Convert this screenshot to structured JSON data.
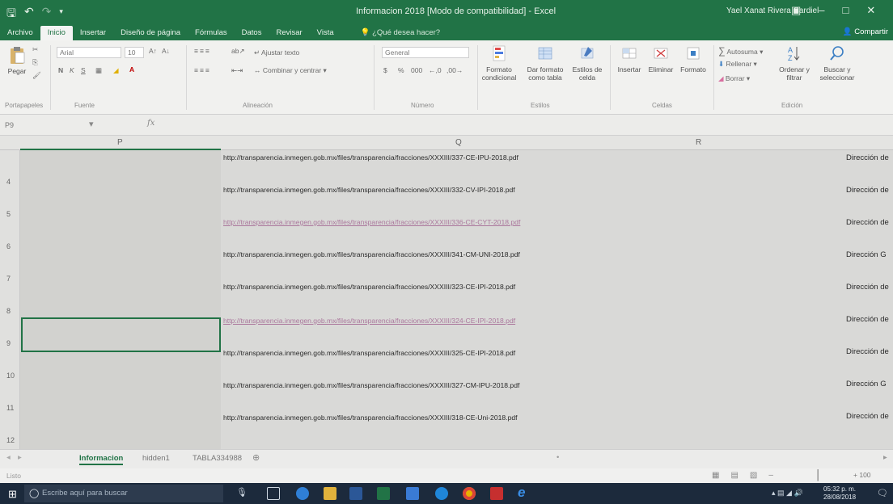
{
  "window": {
    "title": "Informacion 2018 [Modo de compatibilidad] - Excel",
    "user": "Yael Xanat Rivera Cardiel"
  },
  "ribbon_tabs": [
    "Archivo",
    "Inicio",
    "Insertar",
    "Diseño de página",
    "Fórmulas",
    "Datos",
    "Revisar",
    "Vista"
  ],
  "active_tab": "Inicio",
  "tell_me": "¿Qué desea hacer?",
  "share_label": "Compartir",
  "ribbon": {
    "clipboard": {
      "paste": "Pegar",
      "group": "Portapapeles"
    },
    "font": {
      "name": "Arial",
      "size": "10",
      "bold": "N",
      "italic": "K",
      "underline": "S",
      "group": "Fuente"
    },
    "alignment": {
      "wrap": "Ajustar texto",
      "merge": "Combinar y centrar",
      "group": "Alineación"
    },
    "number": {
      "format": "General",
      "currency": "$",
      "percent": "%",
      "thousands": "000",
      "group": "Número"
    },
    "styles": {
      "conditional": "Formato condicional",
      "table": "Dar formato como tabla",
      "cell_styles": "Estilos de celda",
      "group": "Estilos"
    },
    "cells": {
      "insert": "Insertar",
      "delete": "Eliminar",
      "format": "Formato",
      "group": "Celdas"
    },
    "editing": {
      "autosum": "Autosuma",
      "fill": "Rellenar",
      "clear": "Borrar",
      "sort": "Ordenar y filtrar",
      "find": "Buscar y seleccionar",
      "group": "Edición"
    }
  },
  "formula_bar": {
    "name_box": "P9",
    "fx": "fx",
    "content": ""
  },
  "columns": [
    "P",
    "Q",
    "R"
  ],
  "rows": [
    {
      "num": "4",
      "url": "http://transparencia.inmegen.gob.mx/files/transparencia/fracciones/XXXIII/332-CV-IPI-2018.pdf",
      "dir": "Dirección de",
      "visited": false
    },
    {
      "num": "5",
      "url": "http://transparencia.inmegen.gob.mx/files/transparencia/fracciones/XXXIII/336-CE-CYT-2018.pdf",
      "dir": "Dirección de",
      "visited": true
    },
    {
      "num": "6",
      "url": "http://transparencia.inmegen.gob.mx/files/transparencia/fracciones/XXXIII/341-CM-UNI-2018.pdf",
      "dir": "Dirección G",
      "visited": false
    },
    {
      "num": "7",
      "url": "http://transparencia.inmegen.gob.mx/files/transparencia/fracciones/XXXIII/323-CE-IPI-2018.pdf",
      "dir": "Dirección de",
      "visited": false
    },
    {
      "num": "8",
      "url": "http://transparencia.inmegen.gob.mx/files/transparencia/fracciones/XXXIII/324-CE-IPI-2018.pdf",
      "dir": "Dirección de",
      "visited": true
    },
    {
      "num": "9",
      "url": "http://transparencia.inmegen.gob.mx/files/transparencia/fracciones/XXXIII/325-CE-IPI-2018.pdf",
      "dir": "Dirección de",
      "visited": false
    },
    {
      "num": "10",
      "url": "http://transparencia.inmegen.gob.mx/files/transparencia/fracciones/XXXIII/327-CM-IPU-2018.pdf",
      "dir": "Dirección G",
      "visited": false
    },
    {
      "num": "11",
      "url": "http://transparencia.inmegen.gob.mx/files/transparencia/fracciones/XXXIII/318-CE-Uni-2018.pdf",
      "dir": "Dirección de",
      "visited": false
    },
    {
      "num": "12",
      "url": "",
      "dir": "",
      "visited": false
    }
  ],
  "top_row": {
    "url": "http://transparencia.inmegen.gob.mx/files/transparencia/fracciones/XXXIII/337-CE-IPU-2018.pdf",
    "dir": "Dirección de"
  },
  "sheets": [
    "Informacion",
    "hidden1",
    "TABLA334988"
  ],
  "active_sheet": "Informacion",
  "status": {
    "label": "Listo",
    "zoom": "100"
  },
  "taskbar": {
    "search_placeholder": "Escribe aquí para buscar",
    "time": "05:32 p. m.",
    "date": "28/08/2018"
  },
  "colors": {
    "excel_green": "#217346",
    "visited_link": "#a0618f",
    "taskbar": "#1c2a3c"
  }
}
